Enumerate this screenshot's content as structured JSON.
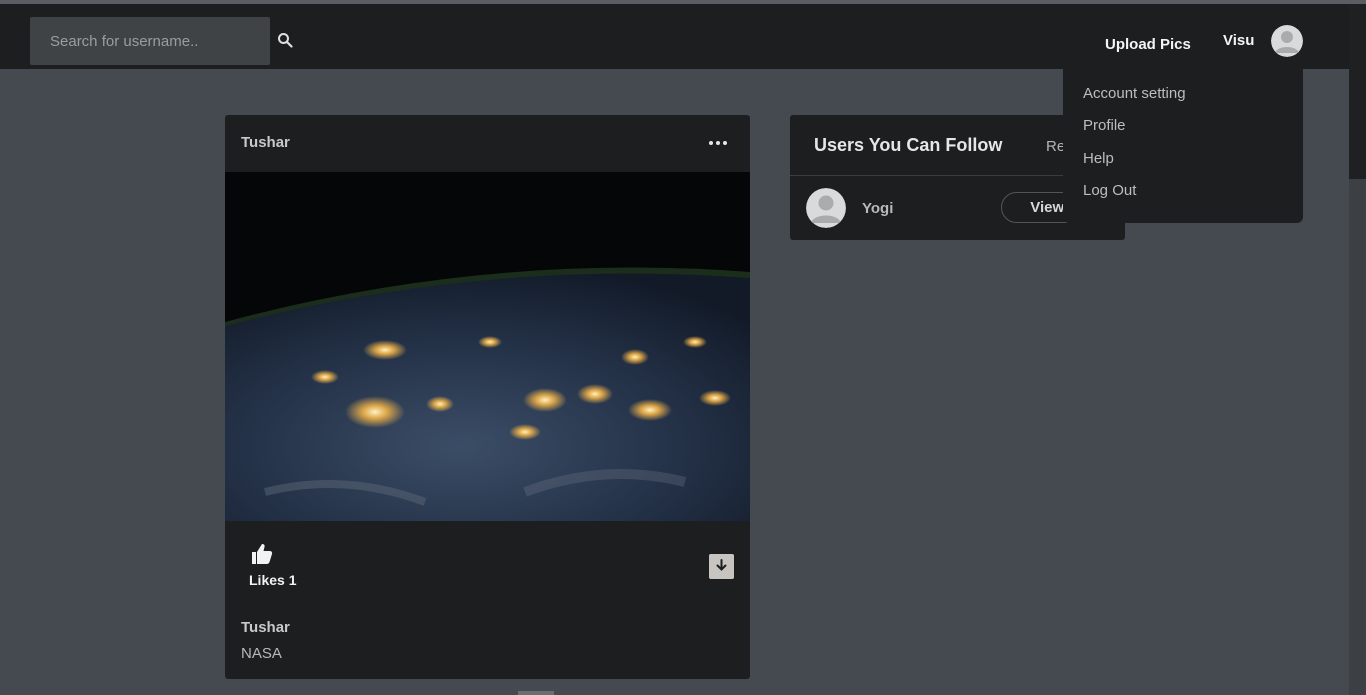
{
  "navbar": {
    "search": {
      "placeholder": "Search for username..",
      "value": ""
    },
    "upload_label": "Upload Pics",
    "user_name": "Visu"
  },
  "dropdown": {
    "items": [
      "Account setting",
      "Profile",
      "Help",
      "Log Out"
    ]
  },
  "post": {
    "author": "Tushar",
    "likes_text": "Likes 1",
    "caption_author": "Tushar",
    "caption_text": "NASA"
  },
  "follow": {
    "title": "Users You Can Follow",
    "refresh_label": "Refresh",
    "users": [
      {
        "name": "Yogi",
        "button_label": "View User"
      }
    ]
  },
  "colors": {
    "page_bg": "#444a4f",
    "card_bg": "#1d1e20",
    "navbar_bg": "#1d1e20"
  },
  "icons": {
    "search": "search-icon",
    "more": "more-horizontal-icon",
    "like": "thumbs-up-icon",
    "download": "download-icon",
    "avatar": "user-avatar-icon"
  }
}
